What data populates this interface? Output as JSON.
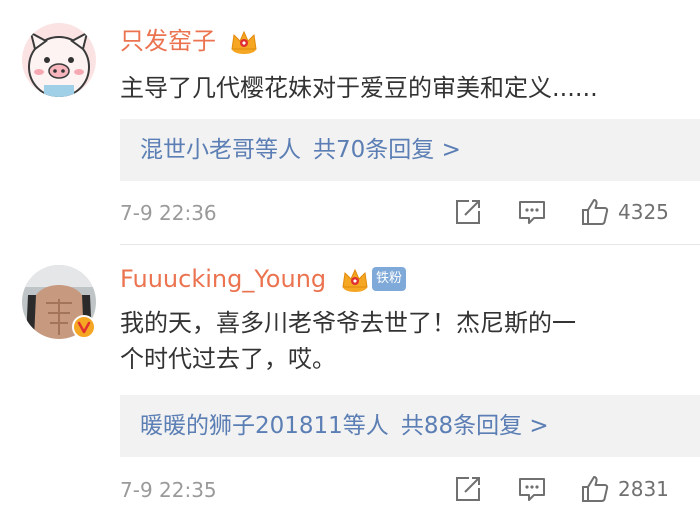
{
  "comments": [
    {
      "username": "只发窑子",
      "text": "主导了几代樱花妹对于爱豆的审美和定义......",
      "text_line2": "",
      "replies_users": "混世小老哥等人",
      "replies_count": "共70条回复 >",
      "timestamp": "7-9 22:36",
      "likes": "4325",
      "avatar": "pig-avatar-icon"
    },
    {
      "username": "Fuuucking_Young",
      "badge": "铁粉",
      "text": "我的天，喜多川老爷爷去世了！杰尼斯的一",
      "text_line2": "个时代过去了，哎。",
      "replies_users": "暖暖的狮子201811等人",
      "replies_count": "共88条回复 >",
      "timestamp": "7-9 22:35",
      "likes": "2831",
      "avatar": "user-photo-avatar"
    }
  ],
  "colors": {
    "username": "#eb7350",
    "link": "#5b7eb4",
    "text": "#333333",
    "muted": "#9a9a9a",
    "crown": "#f5a623",
    "fan_badge": "#7fa9d8",
    "reply_bg": "#f2f2f2"
  }
}
